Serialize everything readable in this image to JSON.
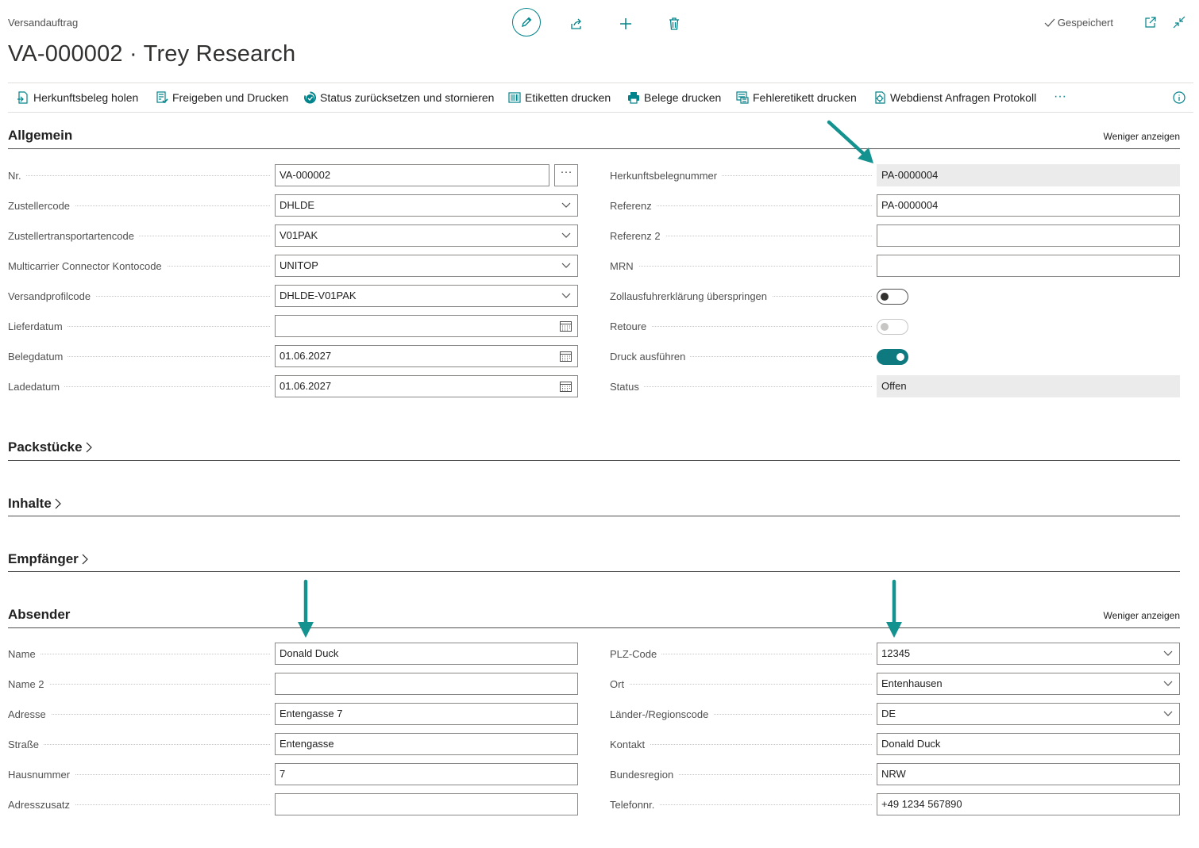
{
  "header": {
    "breadcrumb": "Versandauftrag",
    "title": "VA-000002 · Trey Research",
    "saved_status": "Gespeichert"
  },
  "actions": [
    {
      "label": "Herkunftsbeleg holen",
      "icon": "get-source-document-icon"
    },
    {
      "label": "Freigeben und Drucken",
      "icon": "release-print-icon"
    },
    {
      "label": "Status zurücksetzen und stornieren",
      "icon": "reset-status-icon"
    },
    {
      "label": "Etiketten drucken",
      "icon": "barcode-label-icon"
    },
    {
      "label": "Belege drucken",
      "icon": "printer-icon"
    },
    {
      "label": "Fehleretikett drucken",
      "icon": "error-label-icon"
    },
    {
      "label": "Webdienst Anfragen Protokoll",
      "icon": "webservice-log-icon"
    },
    {
      "label": "···",
      "icon": "more-icon"
    }
  ],
  "general": {
    "title": "Allgemein",
    "less_label": "Weniger anzeigen",
    "left_fields": [
      {
        "label": "Nr.",
        "value": "VA-000002",
        "type": "lookup"
      },
      {
        "label": "Zustellercode",
        "value": "DHLDE",
        "type": "dropdown"
      },
      {
        "label": "Zustellertransportartencode",
        "value": "V01PAK",
        "type": "dropdown"
      },
      {
        "label": "Multicarrier Connector Kontocode",
        "value": "UNITOP",
        "type": "dropdown"
      },
      {
        "label": "Versandprofilcode",
        "value": "DHLDE-V01PAK",
        "type": "dropdown"
      },
      {
        "label": "Lieferdatum",
        "value": "",
        "type": "date"
      },
      {
        "label": "Belegdatum",
        "value": "01.06.2027",
        "type": "date"
      },
      {
        "label": "Ladedatum",
        "value": "01.06.2027",
        "type": "date"
      }
    ],
    "right_fields": [
      {
        "label": "Herkunftsbelegnummer",
        "value": "PA-0000004",
        "type": "readonly"
      },
      {
        "label": "Referenz",
        "value": "PA-0000004",
        "type": "text"
      },
      {
        "label": "Referenz 2",
        "value": "",
        "type": "text"
      },
      {
        "label": "MRN",
        "value": "",
        "type": "text"
      },
      {
        "label": "Zollausfuhrerklärung überspringen",
        "value": "off",
        "type": "toggle"
      },
      {
        "label": "Retoure",
        "value": "off-disabled",
        "type": "toggle"
      },
      {
        "label": "Druck ausführen",
        "value": "on",
        "type": "toggle"
      },
      {
        "label": "Status",
        "value": "Offen",
        "type": "readonly"
      }
    ]
  },
  "collapsed_sections": [
    "Packstücke",
    "Inhalte",
    "Empfänger"
  ],
  "sender": {
    "title": "Absender",
    "less_label": "Weniger anzeigen",
    "left_fields": [
      {
        "label": "Name",
        "value": "Donald Duck",
        "type": "text"
      },
      {
        "label": "Name 2",
        "value": "",
        "type": "text"
      },
      {
        "label": "Adresse",
        "value": "Entengasse 7",
        "type": "text"
      },
      {
        "label": "Straße",
        "value": "Entengasse",
        "type": "text"
      },
      {
        "label": "Hausnummer",
        "value": "7",
        "type": "text"
      },
      {
        "label": "Adresszusatz",
        "value": "",
        "type": "text"
      }
    ],
    "right_fields": [
      {
        "label": "PLZ-Code",
        "value": "12345",
        "type": "dropdown"
      },
      {
        "label": "Ort",
        "value": "Entenhausen",
        "type": "dropdown"
      },
      {
        "label": "Länder-/Regionscode",
        "value": "DE",
        "type": "dropdown"
      },
      {
        "label": "Kontakt",
        "value": "Donald Duck",
        "type": "text"
      },
      {
        "label": "Bundesregion",
        "value": "NRW",
        "type": "text"
      },
      {
        "label": "Telefonnr.",
        "value": "+49 1234 567890",
        "type": "text"
      }
    ]
  },
  "colors": {
    "accent": "#00838a",
    "arrow": "#13928f",
    "toggle_on": "#0e7a80"
  }
}
